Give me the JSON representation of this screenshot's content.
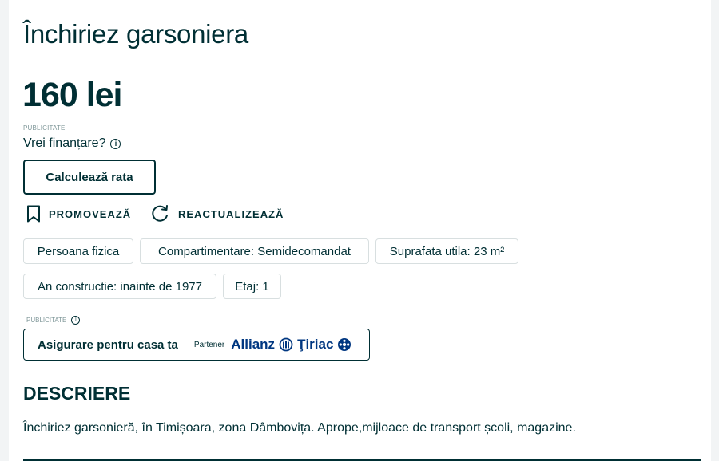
{
  "listing": {
    "title": "Închiriez garsoniera",
    "price": "160 lei"
  },
  "finance": {
    "ad_label": "PUBLICITATE",
    "question": "Vrei finanțare?",
    "info_icon": "info-icon",
    "calculate_button": "Calculează rata"
  },
  "actions": {
    "promote": {
      "label": "PROMOVEAZĂ",
      "icon": "bookmark-icon"
    },
    "reupdate": {
      "label": "REACTUALIZEAZĂ",
      "icon": "refresh-icon"
    }
  },
  "tags": [
    "Persoana fizica",
    "Compartimentare: Semidecomandat",
    "Suprafata utila: 23 m²",
    "An constructie: inainte de 1977",
    "Etaj: 1"
  ],
  "insurance": {
    "ad_label": "PUBLICITATE",
    "title": "Asigurare pentru casa ta",
    "partner_label": "Partener",
    "brand_allianz": "Allianz",
    "brand_tiriac": "Ţiriac",
    "brand_color": "#003781"
  },
  "description": {
    "heading": "DESCRIERE",
    "text": "Închiriez garsonieră, în Timișoara, zona Dâmbovița. Aprope,mijloace de transport școli, magazine."
  },
  "colors": {
    "text": "#002f34",
    "muted": "#7f9799",
    "border": "#d8dfe0"
  }
}
